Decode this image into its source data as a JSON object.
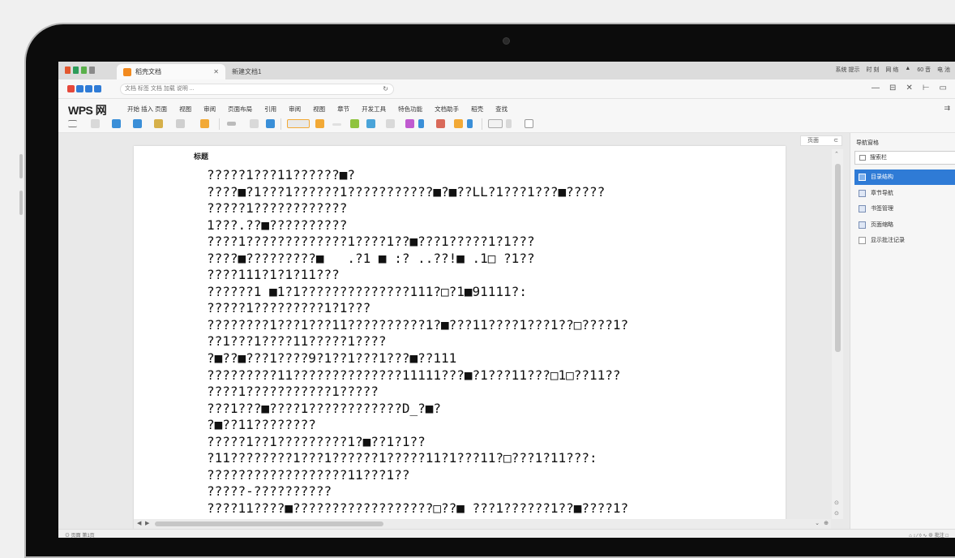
{
  "tabs": {
    "active": "稻壳文档",
    "inactive": "新建文档1"
  },
  "system_tray": [
    "系统 提示",
    "时 刻",
    "网 络",
    "▲",
    "60 音",
    "电 池"
  ],
  "address": {
    "value": "文档 标签 文档 加载 说明 ...",
    "reload": "↻"
  },
  "window_controls": [
    "—",
    "⊟",
    "✕",
    "⊢",
    "▭"
  ],
  "menu": {
    "logo": "WPS 网",
    "items": [
      "开始 插入 页面",
      "视图",
      "审阅",
      "页面布局",
      "引用",
      "审阅",
      "视图",
      "章节",
      "开发工具",
      "特色功能",
      "文档助手",
      "稻壳",
      "查找"
    ],
    "right": "⇉"
  },
  "document": {
    "header": "标题",
    "lines": [
      "?????1???11??????■?",
      "????■?1???1??????1???????????■?■??LL?1???1???■?????",
      "?????1????????????",
      "1???.??■??????????",
      "????1?????????????1????1??■???1?????1?1???",
      "????■?????????■   .?1 ■ :? ..??!■ .1□ ?1??",
      "????111?1?1?11???",
      "??????1 ■1?1??????????????111?□?1■91111?:",
      "?????1?????????1?1???",
      "????????1???1???11??????????1?■???11????1???1??□????1?",
      "??1???1????11?????1????",
      "?■??■???1????9?1??1???1???■??111",
      "?????????11??????????????11111???■?1???11???□1□??11??",
      "????1???????????1?????",
      "???1???■????1????????????D_?■?",
      "?■??11????????",
      "?????1??1?????????1?■??1?1??",
      "?11????????1???1??????1?????11?1???11?□???1?11???:",
      "??????????????????11???1??",
      "?????-??????????",
      "????11????■??????????????????□??■ ???1??????1??■????1?"
    ]
  },
  "zoom": {
    "label": "页面",
    "icon": "⊂"
  },
  "panel": {
    "title": "导航窗格",
    "search_value": "搜索栏",
    "items": [
      {
        "label": "目录结构",
        "selected": true
      },
      {
        "label": "章节导航",
        "selected": false
      },
      {
        "label": "书签管理",
        "selected": false
      },
      {
        "label": "页面缩略",
        "selected": false
      },
      {
        "label": "显示批注记录",
        "selected": false
      }
    ]
  },
  "status": {
    "left": "⊙ 页面 第1页",
    "right": "⌂ ↕ ∕ ◊ ∿ ⊕ 批注   □"
  },
  "colors": {
    "accent": "#2f7bd6",
    "tab_logo": "#f28a1f",
    "bezel": "#0c0c0c"
  }
}
